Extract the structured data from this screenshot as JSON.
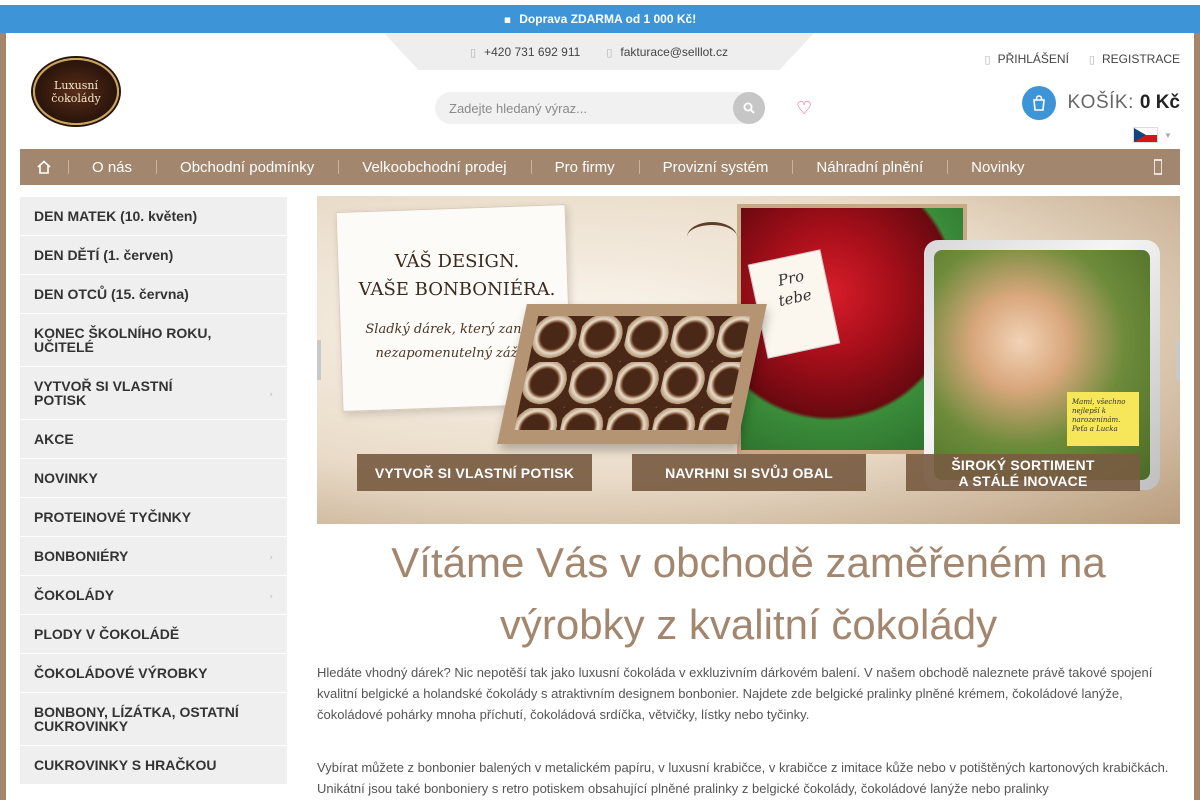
{
  "promo": {
    "icon": "truck-icon",
    "text": "Doprava ZDARMA od 1 000 Kč!"
  },
  "contacts": {
    "phone": "+420 731 692 911",
    "email": "fakturace@selllot.cz"
  },
  "logo": {
    "line1": "Luxusní",
    "line2": "čokolády"
  },
  "search": {
    "placeholder": "Zadejte hledaný výraz..."
  },
  "account": {
    "login": "PŘIHLÁŠENÍ",
    "register": "REGISTRACE"
  },
  "cart": {
    "label": "KOŠÍK:",
    "total": "0 Kč"
  },
  "nav": {
    "items": [
      "O nás",
      "Obchodní podmínky",
      "Velkoobchodní prodej",
      "Pro firmy",
      "Provizní systém",
      "Náhradní plnění",
      "Novinky"
    ]
  },
  "sidebar": {
    "items": [
      {
        "label": "DEN MATEK (10. květen)",
        "has_sub": false
      },
      {
        "label": "DEN DĚTÍ (1. červen)",
        "has_sub": false
      },
      {
        "label": "DEN OTCŮ (15. června)",
        "has_sub": false
      },
      {
        "label": "KONEC ŠKOLNÍHO ROKU, UČITELÉ",
        "has_sub": false
      },
      {
        "label": "VYTVOŘ SI VLASTNÍ POTISK",
        "has_sub": true
      },
      {
        "label": "AKCE",
        "has_sub": false
      },
      {
        "label": "NOVINKY",
        "has_sub": false
      },
      {
        "label": "PROTEINOVÉ TYČINKY",
        "has_sub": false
      },
      {
        "label": "BONBONIÉRY",
        "has_sub": true
      },
      {
        "label": "ČOKOLÁDY",
        "has_sub": true
      },
      {
        "label": "PLODY V ČOKOLÁDĚ",
        "has_sub": false
      },
      {
        "label": "ČOKOLÁDOVÉ VÝROBKY",
        "has_sub": false
      },
      {
        "label": "BONBONY, LÍZÁTKA, OSTATNÍ CUKROVINKY",
        "has_sub": false
      },
      {
        "label": "CUKROVINKY S HRAČKOU",
        "has_sub": false
      }
    ]
  },
  "hero": {
    "card_title_1": "VÁŠ DESIGN.",
    "card_title_2": "VAŠE BONBONIÉRA.",
    "card_sub_1": "Sladký dárek, který zanechá",
    "card_sub_2": "nezapomenutelný zážitek",
    "card_pro_1": "Pro",
    "card_pro_2": "tebe",
    "note": "Mami, všechno nejlepší k narozeninám. Peťa a Lucka",
    "cta1": "VYTVOŘ SI VLASTNÍ POTISK",
    "cta2": "NAVRHNI SI SVŮJ OBAL",
    "cta3_1": "ŠIROKÝ SORTIMENT",
    "cta3_2": "A STÁLÉ INOVACE"
  },
  "welcome": {
    "line1": "Vítáme Vás v obchodě zaměřeném na",
    "line2": "výrobky z kvalitní čokolády"
  },
  "paragraphs": {
    "p1": "Hledáte vhodný dárek? Nic nepotěší tak jako luxusní čokoláda v exkluzivním dárkovém balení. V našem obchodě naleznete právě takové spojení kvalitní belgické a holandské čokolády s atraktivním designem bonbonier. Najdete zde belgické pralinky plněné krémem, čokoládové lanýže, čokoládové pohárky mnoha příchutí, čokoládová srdíčka, větvičky, lístky nebo tyčinky.",
    "p2": "Vybírat můžete z bonbonier balených v metalickém papíru, v luxusní krabičce, v krabičce z imitace kůže nebo v potištěných kartonových krabičkách. Unikátní jsou také bonboniery s retro potiskem obsahující plněné pralinky z belgické čokolády, čokoládové lanýže nebo pralinky"
  },
  "colors": {
    "accent": "#a2866d",
    "blue": "#3d95d8",
    "sidebar_bg": "#efefef"
  }
}
